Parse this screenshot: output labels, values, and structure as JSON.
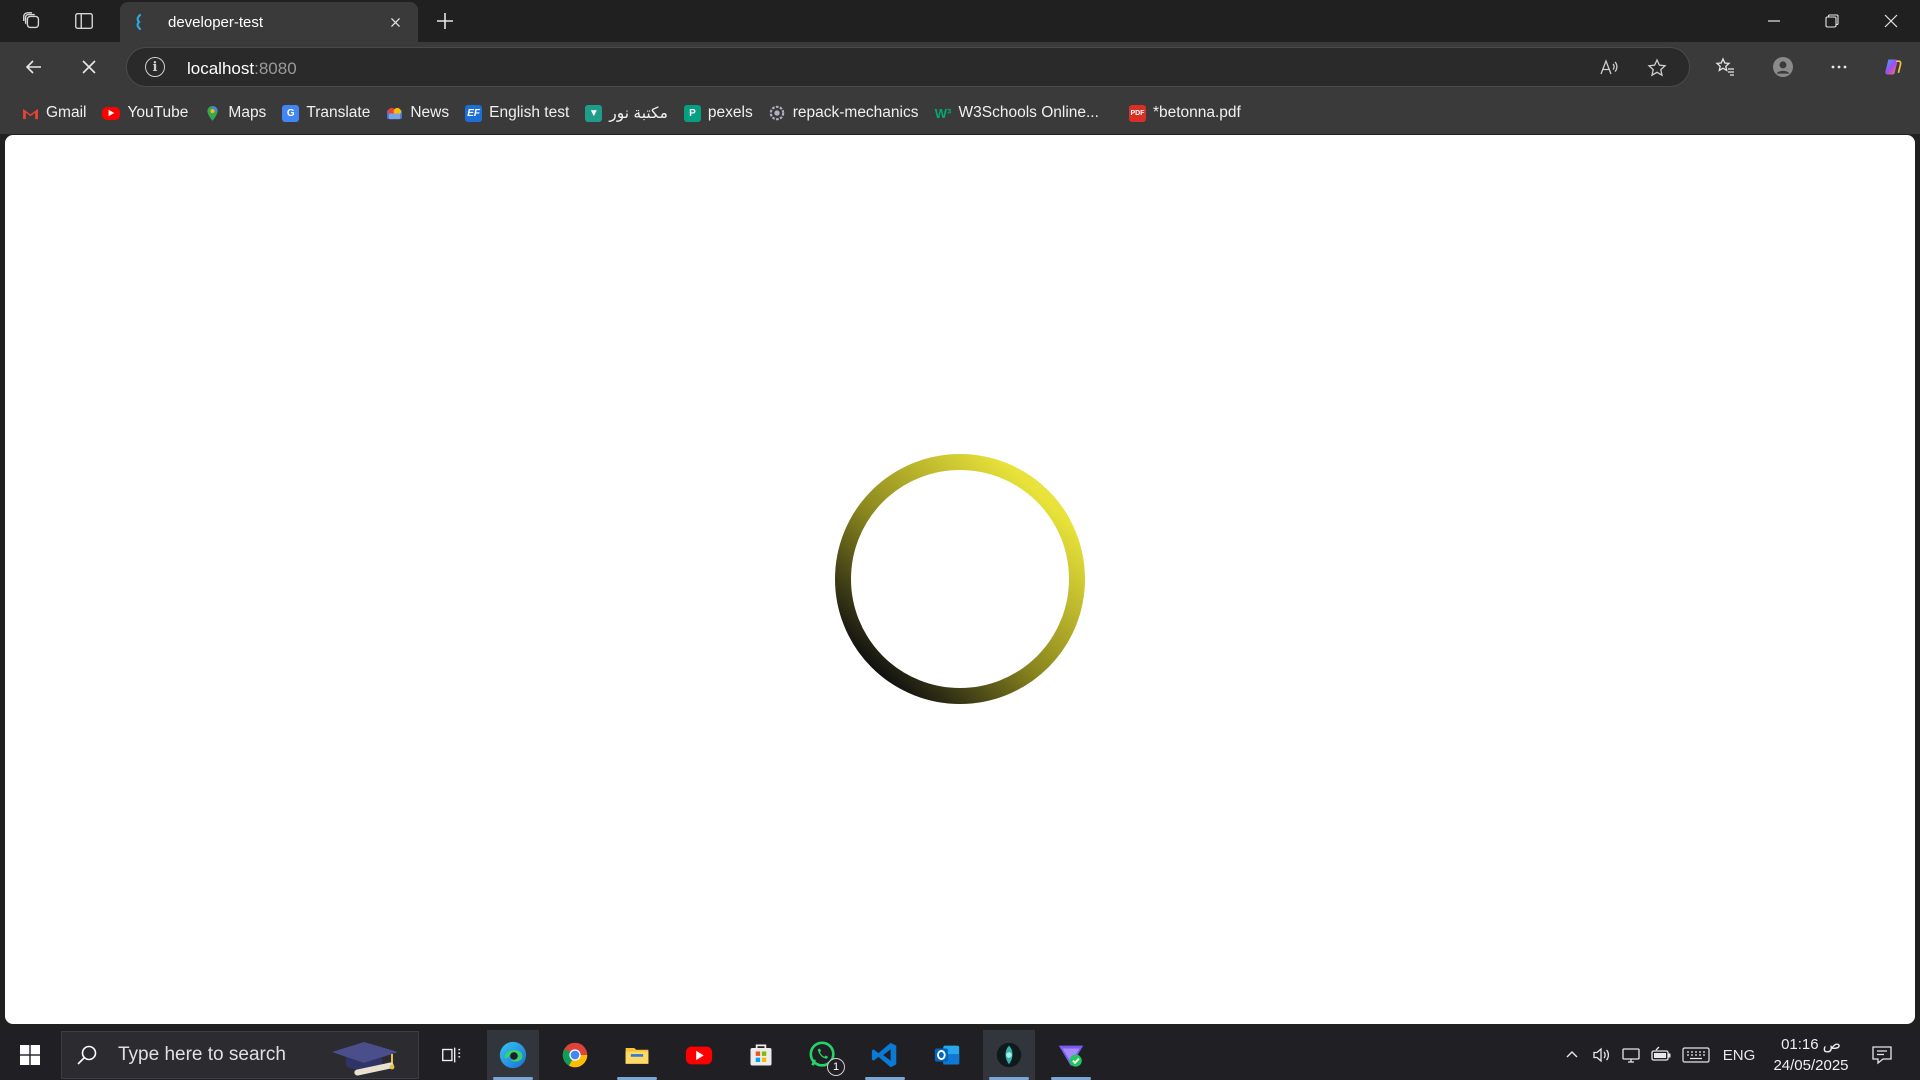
{
  "browser": {
    "tab": {
      "title": "developer-test"
    },
    "address": {
      "host": "localhost",
      "port": ":8080"
    }
  },
  "bookmarks": [
    {
      "label": "Gmail",
      "icon": "gmail-icon",
      "color": "#ea4335"
    },
    {
      "label": "YouTube",
      "icon": "youtube-icon",
      "color": "#ff0000"
    },
    {
      "label": "Maps",
      "icon": "maps-icon",
      "color": "#34a853"
    },
    {
      "label": "Translate",
      "icon": "translate-icon",
      "color": "#4285f4"
    },
    {
      "label": "News",
      "icon": "news-icon",
      "color": "#4a7bd8"
    },
    {
      "label": "English test",
      "icon": "ef-icon",
      "color": "#1d6fd8"
    },
    {
      "label": "مكتبة نور",
      "icon": "noor-library-icon",
      "color": "#1f9d8a"
    },
    {
      "label": "pexels",
      "icon": "pexels-icon",
      "color": "#05a081"
    },
    {
      "label": "repack-mechanics",
      "icon": "repack-icon",
      "color": "#7c7c90"
    },
    {
      "label": "W3Schools Online...",
      "icon": "w3schools-icon",
      "color": "#04aa6d"
    },
    {
      "label": "*betonna.pdf",
      "icon": "pdf-icon",
      "color": "#d93025"
    }
  ],
  "page": {
    "state": "loading",
    "spinner": {
      "color_start": "#e8e23a",
      "color_end": "#111111"
    }
  },
  "taskbar": {
    "search_placeholder": "Type here to search",
    "apps": [
      "task-view-icon",
      "edge-icon",
      "chrome-icon",
      "file-explorer-icon",
      "youtube-app-icon",
      "store-icon",
      "whatsapp-icon",
      "vscode-icon",
      "outlook-icon",
      "app-icon",
      "app-icon-2"
    ],
    "whatsapp_badge": "1",
    "language": "ENG",
    "time": "01:16 ص",
    "date": "24/05/2025"
  }
}
